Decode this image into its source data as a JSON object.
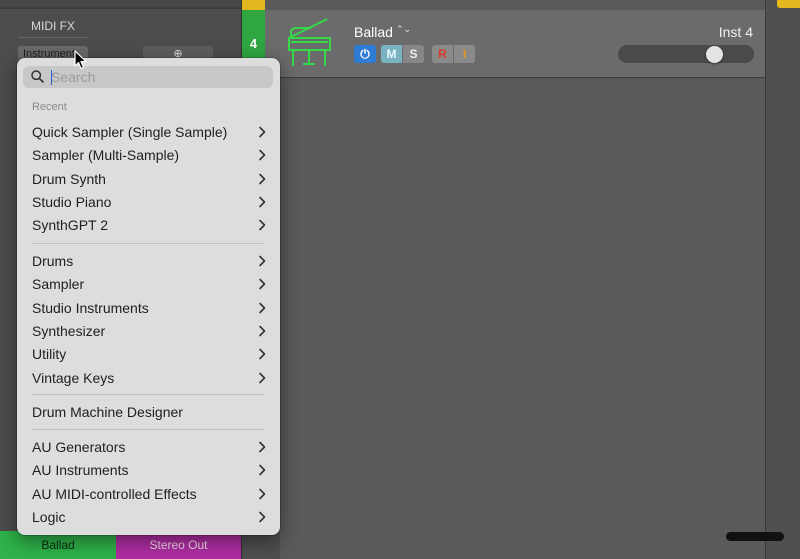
{
  "inspector": {
    "midi_fx_label": "MIDI FX",
    "instrument_slot_label": "Instrument",
    "link_glyph": "⊕",
    "channel_strip_names": [
      "Ballad",
      "Stereo Out"
    ]
  },
  "track": {
    "number": "4",
    "name": "Ballad",
    "name_chevron": "⌃⌄",
    "instrument_label": "Inst 4",
    "icon": "grand-piano-icon",
    "buttons": {
      "power": "⏻",
      "mute": "M",
      "solo": "S",
      "record": "R",
      "input_monitor": "I"
    },
    "volume_fraction": 0.7
  },
  "menu": {
    "search_placeholder": "Search",
    "recent_header": "Recent",
    "recent_items": [
      {
        "label": "Quick Sampler (Single Sample)",
        "submenu": true
      },
      {
        "label": "Sampler (Multi-Sample)",
        "submenu": true
      },
      {
        "label": "Drum Synth",
        "submenu": true
      },
      {
        "label": "Studio Piano",
        "submenu": true
      },
      {
        "label": "SynthGPT 2",
        "submenu": true
      }
    ],
    "category_items": [
      {
        "label": "Drums",
        "submenu": true
      },
      {
        "label": "Sampler",
        "submenu": true
      },
      {
        "label": "Studio Instruments",
        "submenu": true
      },
      {
        "label": "Synthesizer",
        "submenu": true
      },
      {
        "label": "Utility",
        "submenu": true
      },
      {
        "label": "Vintage Keys",
        "submenu": true
      }
    ],
    "standalone_items": [
      {
        "label": "Drum Machine Designer",
        "submenu": false
      }
    ],
    "plugin_items": [
      {
        "label": "AU Generators",
        "submenu": true
      },
      {
        "label": "AU Instruments",
        "submenu": true
      },
      {
        "label": "AU MIDI-controlled Effects",
        "submenu": true
      },
      {
        "label": "Logic",
        "submenu": true
      }
    ]
  },
  "colors": {
    "track_green": "#2fa640",
    "stereo_out_magenta": "#b02ea3",
    "power_blue": "#2e7bd6",
    "record_red": "#d93a2b",
    "input_orange": "#e79a1d",
    "region_yellow": "#e2b81e"
  }
}
